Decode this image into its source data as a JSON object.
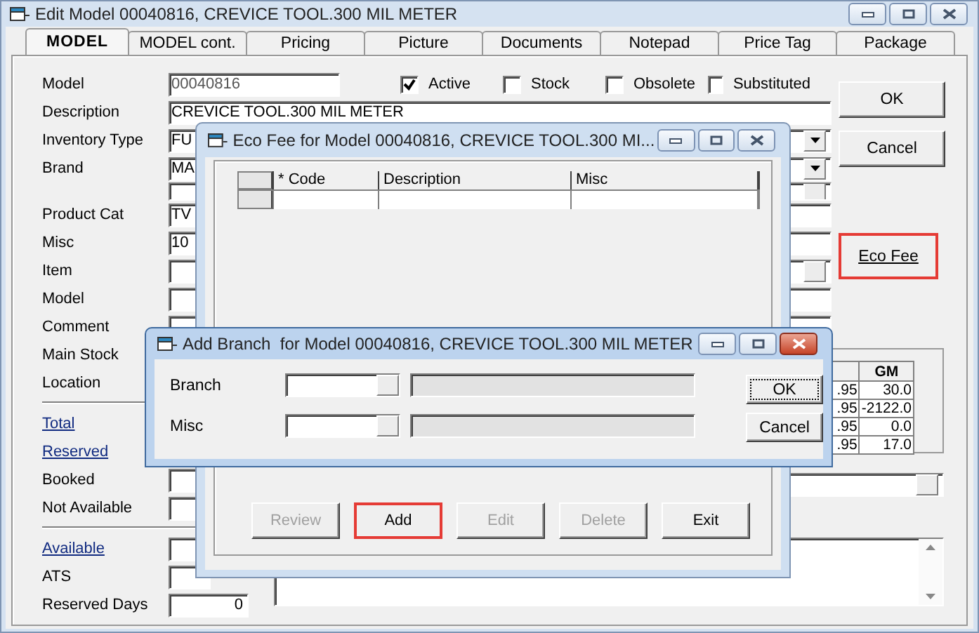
{
  "main_window": {
    "title": "Edit Model 00040816, CREVICE TOOL.300 MIL METER",
    "tabs": [
      {
        "label": "MODEL",
        "selected": true
      },
      {
        "label": "MODEL cont.",
        "selected": false
      },
      {
        "label": "Pricing",
        "selected": false
      },
      {
        "label": "Picture",
        "selected": false
      },
      {
        "label": "Documents",
        "selected": false
      },
      {
        "label": "Notepad",
        "selected": false
      },
      {
        "label": "Price Tag",
        "selected": false
      },
      {
        "label": "Package",
        "selected": false
      }
    ],
    "flags": [
      {
        "label": "Active",
        "checked": true
      },
      {
        "label": "Stock",
        "checked": false
      },
      {
        "label": "Obsolete",
        "checked": false
      },
      {
        "label": "Substituted",
        "checked": false
      }
    ],
    "fields": [
      {
        "kind": "readonly",
        "label": "Model",
        "value": "00040816"
      },
      {
        "kind": "text",
        "label": "Description",
        "value": "CREVICE TOOL.300 MIL METER"
      },
      {
        "kind": "dropdown",
        "label": "Inventory Type",
        "value": "FU"
      },
      {
        "kind": "dropdown",
        "label": "Brand",
        "value": "MA"
      },
      {
        "kind": "lookup"
      },
      {
        "kind": "text",
        "label": "Product Cat",
        "value": "TV"
      },
      {
        "kind": "text",
        "label": "Misc",
        "value": "10"
      },
      {
        "kind": "lookup",
        "label": "Item"
      },
      {
        "kind": "text",
        "label": "Model"
      },
      {
        "kind": "text",
        "label": "Comment"
      }
    ],
    "stock_fields": [
      {
        "kind": "caption",
        "label": "Main Stock"
      },
      {
        "kind": "caption",
        "label": "Location"
      },
      {
        "kind": "rule"
      },
      {
        "kind": "link",
        "label": "Total"
      },
      {
        "kind": "link",
        "label": "Reserved"
      },
      {
        "kind": "field",
        "label": "Booked"
      },
      {
        "kind": "field",
        "label": "Not Available"
      },
      {
        "kind": "rule"
      },
      {
        "kind": "link_field",
        "label": "Available"
      },
      {
        "kind": "field",
        "label": "ATS"
      },
      {
        "kind": "field",
        "label": "Reserved Days",
        "value": "0"
      }
    ],
    "stock_grid": {
      "header": "GM",
      "rows": [
        [
          ".95",
          "30.0"
        ],
        [
          ".95",
          "-2122.0"
        ],
        [
          ".95",
          "0.0"
        ],
        [
          ".95",
          "17.0"
        ]
      ]
    },
    "buttons": [
      {
        "kind": "push",
        "label": "OK",
        "highlighted": false
      },
      {
        "kind": "push",
        "label": "Cancel",
        "highlighted": false
      },
      {
        "kind": "link",
        "label": "Eco Fee",
        "highlighted": true
      }
    ]
  },
  "eco_dialog": {
    "title": "Eco Fee for Model 00040816, CREVICE TOOL.300 MI...",
    "columns": [
      "* Code",
      "Description",
      "Misc"
    ],
    "buttons": [
      {
        "label": "Review",
        "disabled": true,
        "highlighted": false
      },
      {
        "label": "Add",
        "disabled": false,
        "highlighted": true
      },
      {
        "label": "Edit",
        "disabled": true,
        "highlighted": false
      },
      {
        "label": "Delete",
        "disabled": true,
        "highlighted": false
      },
      {
        "label": "Exit",
        "disabled": false,
        "highlighted": false
      }
    ]
  },
  "branch_dialog": {
    "title": "Add Branch  for Model 00040816, CREVICE TOOL.300 MIL METER",
    "fields": [
      {
        "label": "Branch"
      },
      {
        "label": "Misc"
      }
    ],
    "buttons": [
      {
        "label": "OK",
        "focused": true
      },
      {
        "label": "Cancel",
        "focused": false
      }
    ]
  }
}
